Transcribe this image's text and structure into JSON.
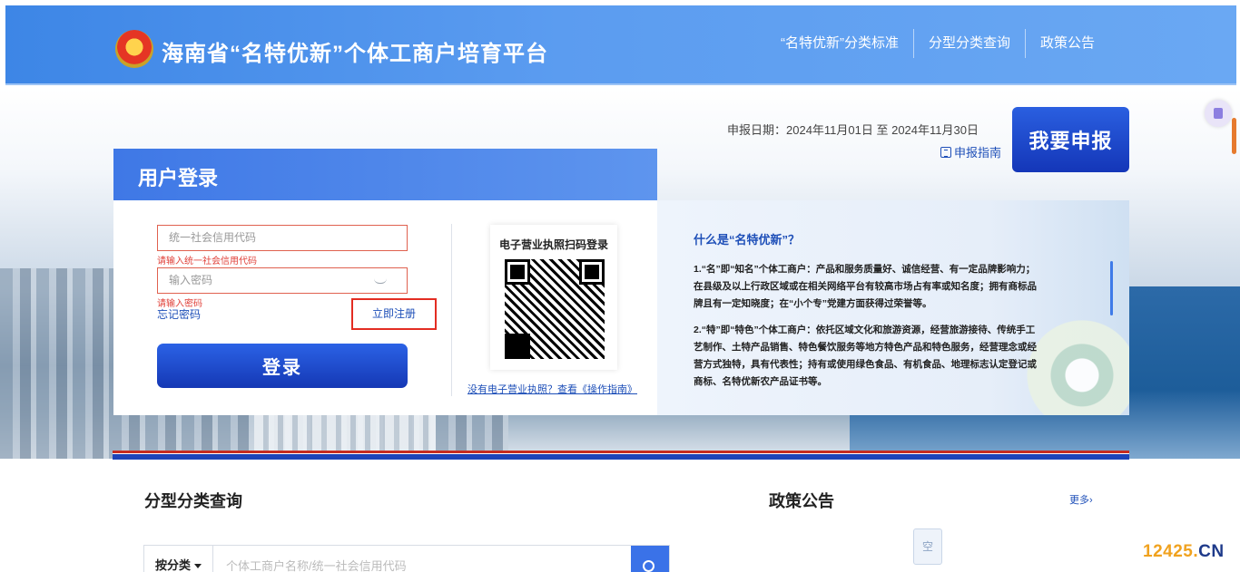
{
  "header": {
    "title": "海南省“名特优新”个体工商户培育平台",
    "nav": [
      "“名特优新”分类标准",
      "分型分类查询",
      "政策公告"
    ]
  },
  "declaration": {
    "date_text": "申报日期：2024年11月01日 至 2024年11月30日",
    "guide_label": "申报指南",
    "apply_button": "我要申报"
  },
  "login": {
    "title": "用户登录",
    "credit_code_placeholder": "统一社会信用代码",
    "credit_code_error": "请输入统一社会信用代码",
    "password_placeholder": "输入密码",
    "password_error": "请输入密码",
    "forgot_label": "忘记密码",
    "register_label": "立即注册",
    "login_button": "登录",
    "qr_title": "电子营业执照扫码登录",
    "qr_note": "没有电子营业执照？查看《操作指南》"
  },
  "info": {
    "question": "什么是“名特优新”？",
    "paragraphs": [
      "1.“名”即“知名”个体工商户：产品和服务质量好、诚信经营、有一定品牌影响力；在县级及以上行政区域或在相关网络平台有较高市场占有率或知名度；拥有商标品牌且有一定知晓度；在“小个专”党建方面获得过荣誉等。",
      "2.“特”即“特色”个体工商户：依托区域文化和旅游资源，经营旅游接待、传统手工艺制作、土特产品销售、特色餐饮服务等地方特色产品和特色服务，经营理念或经营方式独特，具有代表性；持有或使用绿色食品、有机食品、地理标志认定登记或商标、名特优新农产品证书等。"
    ]
  },
  "lower": {
    "query_title": "分型分类查询",
    "policy_title": "政策公告",
    "more_label": "更多›",
    "category_select": "按分类",
    "search_placeholder": "个体工商户名称/统一社会信用代码",
    "empty_label": "空"
  },
  "watermark": {
    "main": "12425.",
    "suffix": "CN"
  },
  "colors": {
    "primary": "#1e4fb8",
    "header": "#4a8ee9",
    "error": "#e0413a",
    "watermark": "#f0a21f"
  }
}
